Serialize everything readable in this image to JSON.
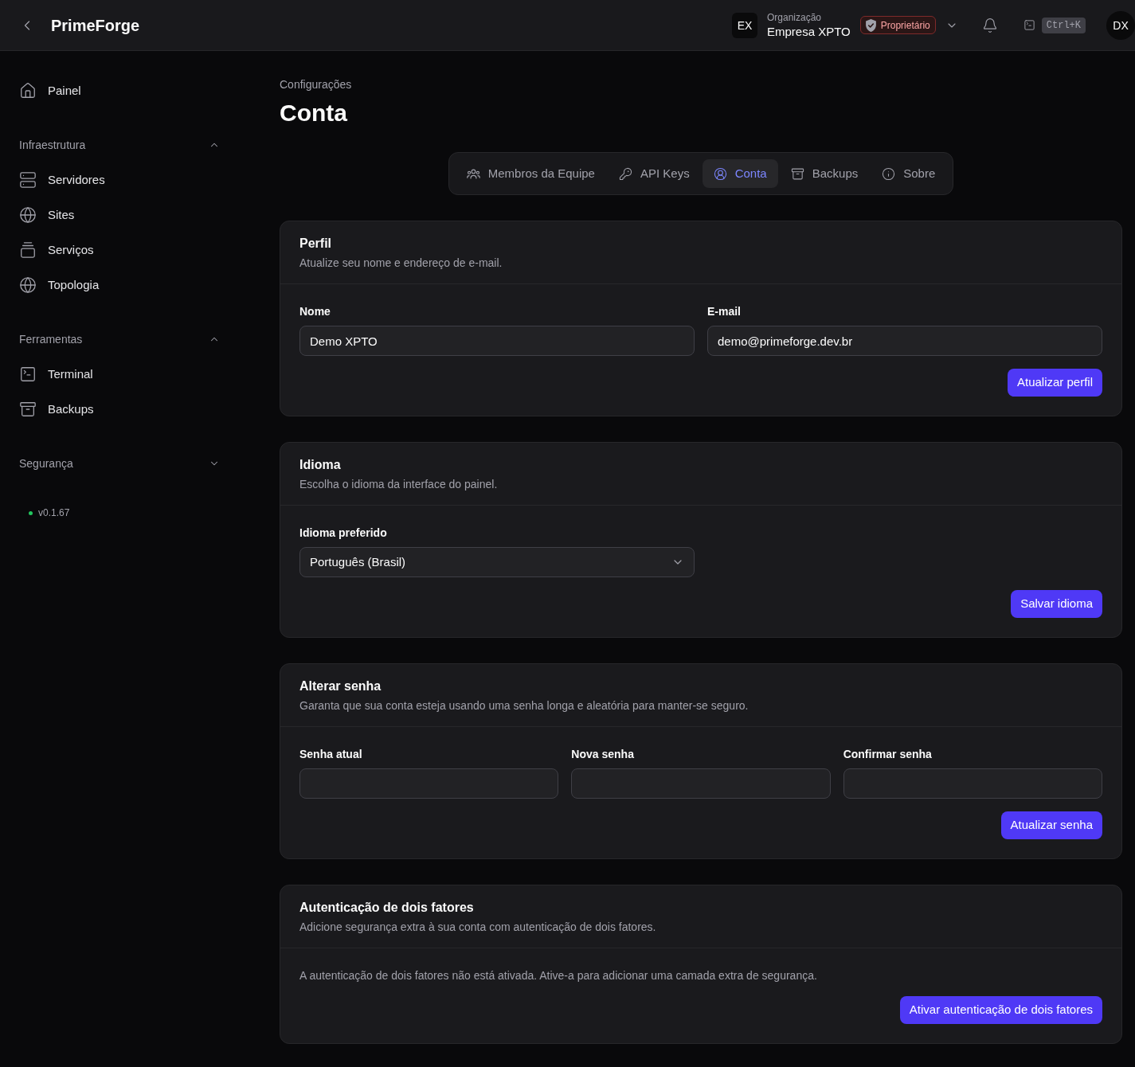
{
  "header": {
    "app_name": "PrimeForge",
    "org_avatar": "EX",
    "org_caption": "Organização",
    "org_name": "Empresa XPTO",
    "role_badge": "Proprietário",
    "shortcut": "Ctrl+K",
    "user_avatar": "DX"
  },
  "sidebar": {
    "top_items": [
      {
        "label": "Painel"
      }
    ],
    "sections": [
      {
        "title": "Infraestrutura",
        "expanded": true,
        "items": [
          {
            "label": "Servidores"
          },
          {
            "label": "Sites"
          },
          {
            "label": "Serviços"
          },
          {
            "label": "Topologia"
          }
        ]
      },
      {
        "title": "Ferramentas",
        "expanded": true,
        "items": [
          {
            "label": "Terminal"
          },
          {
            "label": "Backups"
          }
        ]
      },
      {
        "title": "Segurança",
        "expanded": false
      }
    ],
    "version": "v0.1.67"
  },
  "page": {
    "breadcrumb": "Configurações",
    "title": "Conta"
  },
  "tabs": [
    {
      "label": "Membros da Equipe",
      "selected": false
    },
    {
      "label": "API Keys",
      "selected": false
    },
    {
      "label": "Conta",
      "selected": true
    },
    {
      "label": "Backups",
      "selected": false
    },
    {
      "label": "Sobre",
      "selected": false
    }
  ],
  "cards": [
    {
      "title": "Perfil",
      "description": "Atualize seu nome e endereço de e-mail.",
      "fields": [
        {
          "kind": "text",
          "label": "Nome",
          "value": "Demo XPTO"
        },
        {
          "kind": "text",
          "label": "E-mail",
          "value": "demo@primeforge.dev.br"
        }
      ],
      "button": "Atualizar perfil"
    },
    {
      "title": "Idioma",
      "description": "Escolha o idioma da interface do painel.",
      "fields": [
        {
          "kind": "select",
          "label": "Idioma preferido",
          "value": "Português (Brasil)"
        }
      ],
      "button": "Salvar idioma"
    },
    {
      "title": "Alterar senha",
      "description": "Garanta que sua conta esteja usando uma senha longa e aleatória para manter-se seguro.",
      "fields": [
        {
          "kind": "password",
          "label": "Senha atual"
        },
        {
          "kind": "password",
          "label": "Nova senha"
        },
        {
          "kind": "password",
          "label": "Confirmar senha"
        }
      ],
      "button": "Atualizar senha"
    },
    {
      "title": "Autenticação de dois fatores",
      "description": "Adicione segurança extra à sua conta com autenticação de dois fatores.",
      "message": "A autenticação de dois fatores não está ativada. Ative-a para adicionar uma camada extra de segurança.",
      "button": "Ativar autenticação de dois fatores"
    }
  ]
}
